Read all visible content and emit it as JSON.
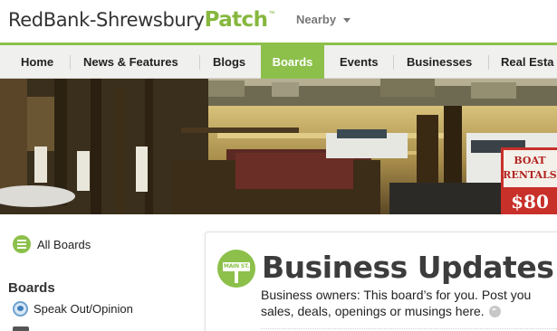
{
  "header": {
    "logo": {
      "town": "RedBank-Shrewsbury",
      "brand": "Patch",
      "trademark": "™"
    },
    "nearby_label": "Nearby"
  },
  "nav": {
    "items": [
      {
        "label": "Home",
        "active": false
      },
      {
        "label": "News & Features",
        "active": false
      },
      {
        "label": "Blogs",
        "active": false
      },
      {
        "label": "Boards",
        "active": true
      },
      {
        "label": "Events",
        "active": false
      },
      {
        "label": "Businesses",
        "active": false
      },
      {
        "label": "Real Esta",
        "active": false
      }
    ]
  },
  "hero": {
    "sign_line_1": "BOAT",
    "sign_line_2": "RENTALS",
    "sign_price": "$80"
  },
  "sidebar": {
    "all_boards_label": "All Boards",
    "boards_heading": "Boards",
    "items": [
      {
        "label": "Speak Out/Opinion",
        "icon": "speech-bubble-icon"
      }
    ]
  },
  "board": {
    "icon_label": "MAIN ST.",
    "title": "Business Updates",
    "description_line_1": "Business owners: This board’s for you. Post you",
    "description_line_2": "sales, deals, openings or musings here."
  },
  "colors": {
    "brand_green": "#8cc04b",
    "title_gray": "#3c3c3c",
    "nav_background": "#f0f0ee"
  }
}
